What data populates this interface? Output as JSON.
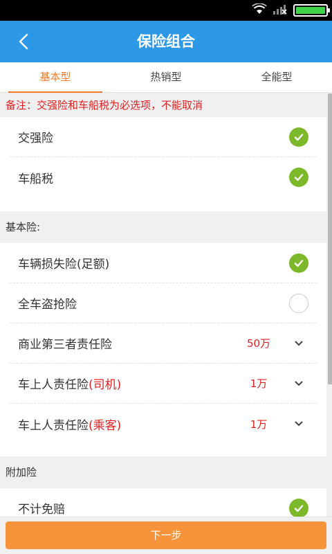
{
  "header": {
    "title": "保险组合"
  },
  "tabs": [
    {
      "label": "基本型",
      "active": true
    },
    {
      "label": "热销型",
      "active": false
    },
    {
      "label": "全能型",
      "active": false
    }
  ],
  "notice": "备注：交强险和车船税为必选项，不能取消",
  "mandatory": [
    {
      "label": "交强险",
      "checked": true
    },
    {
      "label": "车船税",
      "checked": true
    }
  ],
  "basic": {
    "header": "基本险:",
    "items": [
      {
        "label": "车辆损失险(足额)",
        "checked": true
      },
      {
        "label": "全车盗抢险",
        "checked": false
      },
      {
        "label": "商业第三者责任险",
        "value": "50万"
      },
      {
        "label": "车上人责任险",
        "label_accent": "(司机)",
        "value": "1万"
      },
      {
        "label": "车上人责任险",
        "label_accent": "(乘客)",
        "value": "1万"
      }
    ]
  },
  "additional": {
    "header": "附加险",
    "items": [
      {
        "label": "不计免赔",
        "checked": true
      }
    ]
  },
  "footer": {
    "next_label": "下一步"
  },
  "colors": {
    "app_bar": "#2c98e6",
    "accent_orange": "#f07d2a",
    "check_green": "#7cb82a",
    "value_red": "#e02020",
    "button_orange": "#f7943b"
  }
}
